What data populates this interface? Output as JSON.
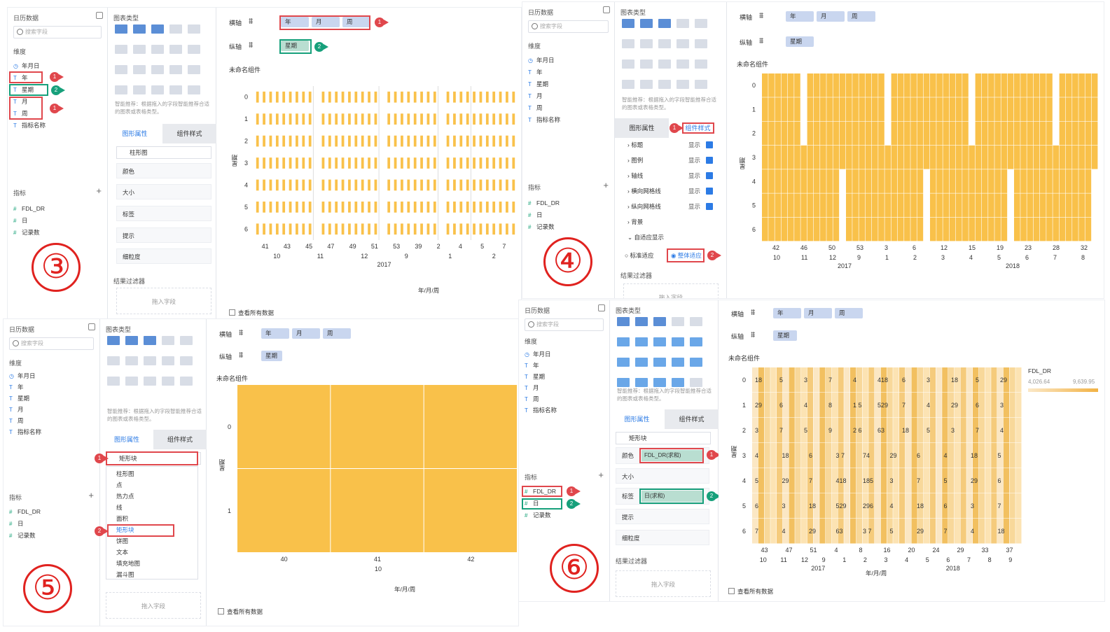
{
  "common": {
    "data_panel_title": "日历数据",
    "search_placeholder": "搜索字段",
    "dimensions_label": "维度",
    "dimension_fields": [
      "年月日",
      "年",
      "星期",
      "月",
      "周",
      "指标名称"
    ],
    "metrics_label": "指标",
    "metric_fields": [
      "FDL_DR",
      "日",
      "记录数"
    ],
    "chart_type_label": "图表类型",
    "hint": "智能推荐：根据拖入的字段智能推荐合适的图表或表格类型。",
    "tab_props": "图形属性",
    "tab_style": "组件样式",
    "prop_rows": [
      "颜色",
      "大小",
      "标签",
      "提示",
      "细粒度"
    ],
    "filter_label": "结果过滤器",
    "filter_drop": "拖入字段",
    "x_axis_label": "横轴",
    "y_axis_label": "纵轴",
    "x_pills": [
      "年",
      "月",
      "周"
    ],
    "y_pill": "星期",
    "component_title": "未命名组件",
    "y_axis_title": "星期",
    "x_axis_title": "年/月/周",
    "view_all": "查看所有数据",
    "accent": "#2c7be5",
    "bar_color": "#f9c14a",
    "highlight_red": "#e0474c",
    "highlight_green": "#17a07b"
  },
  "panel3": {
    "step": "③",
    "chart_kind": "柱形图",
    "y_ticks": [
      "0",
      "1",
      "2",
      "3",
      "4",
      "5",
      "6"
    ],
    "x_week_ticks": [
      "41",
      "43",
      "45",
      "47",
      "49",
      "51",
      "53",
      "39",
      "2",
      "4",
      "5",
      "7"
    ],
    "x_month_ticks": [
      "10",
      "11",
      "12",
      "9",
      "1",
      "2"
    ],
    "x_year_ticks": [
      "2017"
    ],
    "badges": [
      "1",
      "2",
      "1",
      "1",
      "2"
    ]
  },
  "panel4": {
    "step": "④",
    "style_rows": [
      "标题",
      "图例",
      "轴线",
      "横向网格线",
      "纵向网格线",
      "背景",
      "自适应显示"
    ],
    "show_label": "显示",
    "adapt_standard": "标准适应",
    "adapt_whole": "整体适应",
    "y_ticks": [
      "0",
      "1",
      "2",
      "3",
      "4",
      "5",
      "6"
    ],
    "x_week_ticks": [
      "42",
      "46",
      "50",
      "53",
      "3",
      "6",
      "12",
      "15",
      "19",
      "23",
      "28",
      "32"
    ],
    "x_month_ticks": [
      "10",
      "11",
      "12",
      "9",
      "1",
      "2",
      "3",
      "4",
      "5",
      "6",
      "7",
      "8"
    ],
    "x_year_ticks": [
      "2017",
      "2018"
    ],
    "badges": [
      "1",
      "2"
    ]
  },
  "panel5": {
    "step": "⑤",
    "selected_type": "矩形块",
    "menu": [
      "柱形图",
      "点",
      "热力点",
      "线",
      "面积",
      "矩形块",
      "饼图",
      "文本",
      "填充地图",
      "漏斗图"
    ],
    "y_ticks": [
      "0",
      "1"
    ],
    "x_week_ticks": [
      "40",
      "41",
      "42"
    ],
    "x_month_ticks": [
      "10"
    ],
    "badges": [
      "1",
      "2"
    ]
  },
  "panel6": {
    "step": "⑥",
    "chart_kind": "矩形块",
    "color_field": "FDL_DR(求和)",
    "label_field": "日(求和)",
    "legend_title": "FDL_DR",
    "legend_min": "4,026.64",
    "legend_max": "9,639.95",
    "y_ticks": [
      "0",
      "1",
      "2",
      "3",
      "4",
      "5",
      "6"
    ],
    "x_week_ticks": [
      "43",
      "47",
      "51",
      "4",
      "8",
      "16",
      "20",
      "24",
      "29",
      "33",
      "37"
    ],
    "x_month_ticks": [
      "10",
      "11",
      "12",
      "9",
      "1",
      "2",
      "3",
      "4",
      "5",
      "6",
      "7",
      "8",
      "9"
    ],
    "x_year_ticks": [
      "2017",
      "2018"
    ],
    "cell_labels": [
      [
        "18",
        "5",
        "3",
        "7",
        "4",
        "418",
        "6",
        "3",
        "18",
        "5",
        "29"
      ],
      [
        "29",
        "6",
        "4",
        "8",
        "1 5",
        "529",
        "7",
        "4",
        "29",
        "6",
        "3"
      ],
      [
        "3",
        "7",
        "5",
        "9",
        "2 6",
        "63",
        "18",
        "5",
        "3",
        "7",
        "4"
      ],
      [
        "4",
        "18",
        "6",
        "3 7",
        "74",
        "29",
        "6",
        "4",
        "18",
        "5"
      ],
      [
        "5",
        "29",
        "7",
        "418",
        "185",
        "3",
        "7",
        "5",
        "29",
        "6"
      ],
      [
        "6",
        "3",
        "18",
        "529",
        "296",
        "4",
        "18",
        "6",
        "3",
        "7"
      ],
      [
        "7",
        "4",
        "29",
        "63",
        "3 7",
        "5",
        "29",
        "7",
        "4",
        "18"
      ]
    ],
    "badges": [
      "1",
      "2",
      "1",
      "2"
    ]
  }
}
